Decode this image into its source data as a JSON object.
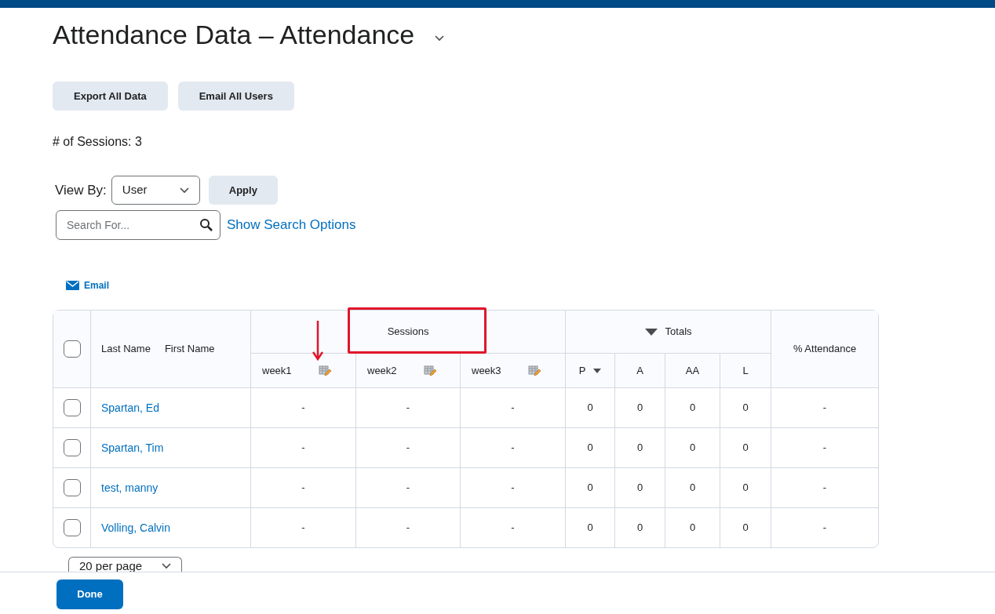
{
  "title": "Attendance Data – Attendance",
  "buttons": [
    "Export All Data",
    "Email All Users"
  ],
  "sessions_count": "# of Sessions: 3",
  "view_by": {
    "label": "View By:",
    "value": "User"
  },
  "apply": "Apply",
  "search": {
    "placeholder": "Search For..."
  },
  "search_options_link": "Show Search Options",
  "email_link": "Email",
  "table": {
    "select_all_checked": false,
    "name_headers": [
      "Last Name",
      "First Name"
    ],
    "sessions_header": "Sessions",
    "totals_header": "Totals",
    "attendance_header": "% Attendance",
    "weeks": [
      "week1",
      "week2",
      "week3"
    ],
    "totals": [
      "P",
      "A",
      "AA",
      "L"
    ],
    "rows": [
      {
        "name": "Spartan, Ed",
        "checked": false,
        "sessions": [
          "-",
          "-",
          "-"
        ],
        "totals": [
          "0",
          "0",
          "0",
          "0"
        ],
        "attendance": "-"
      },
      {
        "name": "Spartan, Tim",
        "checked": false,
        "sessions": [
          "-",
          "-",
          "-"
        ],
        "totals": [
          "0",
          "0",
          "0",
          "0"
        ],
        "attendance": "-"
      },
      {
        "name": "test, manny",
        "checked": false,
        "sessions": [
          "-",
          "-",
          "-"
        ],
        "totals": [
          "0",
          "0",
          "0",
          "0"
        ],
        "attendance": "-"
      },
      {
        "name": "Volling, Calvin",
        "checked": false,
        "sessions": [
          "-",
          "-",
          "-"
        ],
        "totals": [
          "0",
          "0",
          "0",
          "0"
        ],
        "attendance": "-"
      }
    ]
  },
  "per_page": "20 per page",
  "done": "Done"
}
